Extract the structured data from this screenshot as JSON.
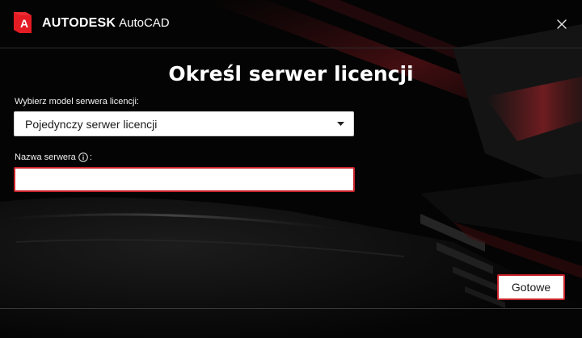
{
  "window": {
    "brand_company": "AUTODESK",
    "brand_product": "AutoCAD",
    "close_icon": "close-icon",
    "logo_letter": "A"
  },
  "main": {
    "title": "Określ serwer licencji",
    "model_label": "Wybierz model serwera licencji:",
    "model_selected": "Pojedynczy serwer licencji",
    "server_label": "Nazwa serwera",
    "server_label_suffix": ":",
    "info_icon": "info-icon",
    "server_value": "",
    "server_placeholder": ""
  },
  "footer": {
    "done_label": "Gotowe"
  },
  "colors": {
    "accent_red": "#c8222a",
    "background": "#030303",
    "field_background": "#ffffff",
    "text_light": "#ffffff",
    "text_dark": "#1a1a1a"
  }
}
